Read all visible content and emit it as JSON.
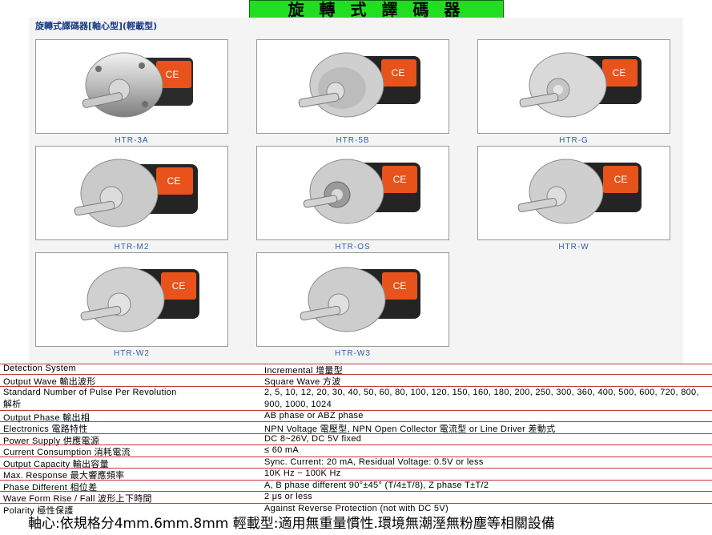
{
  "page_title": "旋 轉 式 譯 碼 器",
  "gallery_heading": "旋轉式譯碼器[軸心型](輕載型)",
  "products": [
    {
      "model": "HTR-3A",
      "image": "rotary-encoder-photo"
    },
    {
      "model": "HTR-5B",
      "image": "rotary-encoder-photo"
    },
    {
      "model": "HTR-G",
      "image": "rotary-encoder-photo"
    },
    {
      "model": "HTR-M2",
      "image": "rotary-encoder-photo"
    },
    {
      "model": "HTR-OS",
      "image": "rotary-encoder-photo"
    },
    {
      "model": "HTR-W",
      "image": "rotary-encoder-photo"
    },
    {
      "model": "HTR-W2",
      "image": "rotary-encoder-photo"
    },
    {
      "model": "HTR-W3",
      "image": "rotary-encoder-photo"
    }
  ],
  "specs": [
    {
      "label": "Detection System",
      "value": "Incremental  增量型"
    },
    {
      "label": "Output Wave  輸出波形",
      "value": "Square Wave  方波"
    },
    {
      "label": "Standard Number of Pulse Per Revolution\n解析",
      "value": "2, 5, 10, 12, 20, 30, 40, 50, 60, 80, 100, 120, 150, 160, 180, 200, 250, 300, 360, 400, 500, 600, 720, 800, 900, 1000, 1024"
    },
    {
      "label": "Output Phase  輸出相",
      "value": "AB phase or ABZ phase"
    },
    {
      "label": "Electronics  電路特性",
      "value": "NPN Voltage 電壓型, NPN Open Collector 電流型  or Line Driver 差動式"
    },
    {
      "label": "Power Supply  供應電源",
      "value": "DC 8~26V, DC 5V fixed"
    },
    {
      "label": "Current Consumption  消耗電流",
      "value": "≤ 60 mA"
    },
    {
      "label": "Output Capacity  輸出容量",
      "value": "Sync. Current: 20 mA, Residual Voltage: 0.5V or less"
    },
    {
      "label": "Max. Response  最大響應頻率",
      "value": "10K Hz ~ 100K Hz"
    },
    {
      "label": "Phase Different  相位差",
      "value": "A, B phase different 90°±45° (T/4±T/8), Z phase T±T/2"
    },
    {
      "label": "Wave Form Rise / Fall  波形上下時間",
      "value": "2 μs or less"
    },
    {
      "label": "Polarity  極性保護",
      "value": "Against Reverse Protection    (not with DC 5V)"
    }
  ],
  "footnote": "軸心:依規格分4mm.6mm.8mm  輕載型:適用無重量慣性.環境無潮溼無粉塵等相關設備",
  "colors": {
    "title_bg": "#22dd22",
    "label_blue": "#2f5fa5",
    "heading_blue": "#1a3b8a",
    "rule_red": "#c53a3a",
    "label_orange": "#e8531c"
  }
}
